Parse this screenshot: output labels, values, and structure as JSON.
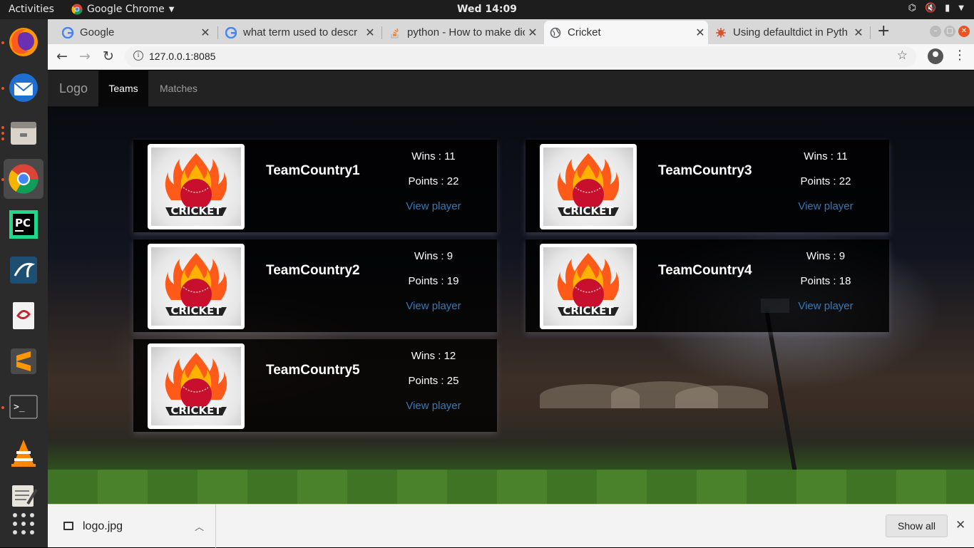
{
  "topbar": {
    "activities": "Activities",
    "app_name": "Google Chrome",
    "clock": "Wed 14:09"
  },
  "dock": {
    "items": [
      "firefox-icon",
      "thunderbird-icon",
      "files-icon",
      "chrome-icon",
      "pycharm-icon",
      "mysql-workbench-icon",
      "evince-icon",
      "sublime-text-icon",
      "terminal-icon",
      "vlc-icon",
      "text-editor-icon",
      "show-apps-icon"
    ]
  },
  "browser": {
    "tabs": [
      {
        "title": "Google"
      },
      {
        "title": "what term used to descr"
      },
      {
        "title": "python - How to make dic"
      },
      {
        "title": "Cricket"
      },
      {
        "title": "Using defaultdict in Pyth"
      }
    ],
    "url": "127.0.0.1:8085"
  },
  "site": {
    "brand": "Logo",
    "nav": {
      "teams": "Teams",
      "matches": "Matches"
    }
  },
  "teams": [
    {
      "name": "TeamCountry1",
      "wins": "Wins : 11",
      "points": "Points : 22",
      "link": "View player"
    },
    {
      "name": "TeamCountry3",
      "wins": "Wins : 11",
      "points": "Points : 22",
      "link": "View player"
    },
    {
      "name": "TeamCountry2",
      "wins": "Wins : 9",
      "points": "Points : 19",
      "link": "View player"
    },
    {
      "name": "TeamCountry4",
      "wins": "Wins : 9",
      "points": "Points : 18",
      "link": "View player"
    },
    {
      "name": "TeamCountry5",
      "wins": "Wins : 12",
      "points": "Points : 25",
      "link": "View player"
    }
  ],
  "team_logo_text": "CRICKET",
  "downloads": {
    "file": "logo.jpg",
    "show_all": "Show all"
  }
}
